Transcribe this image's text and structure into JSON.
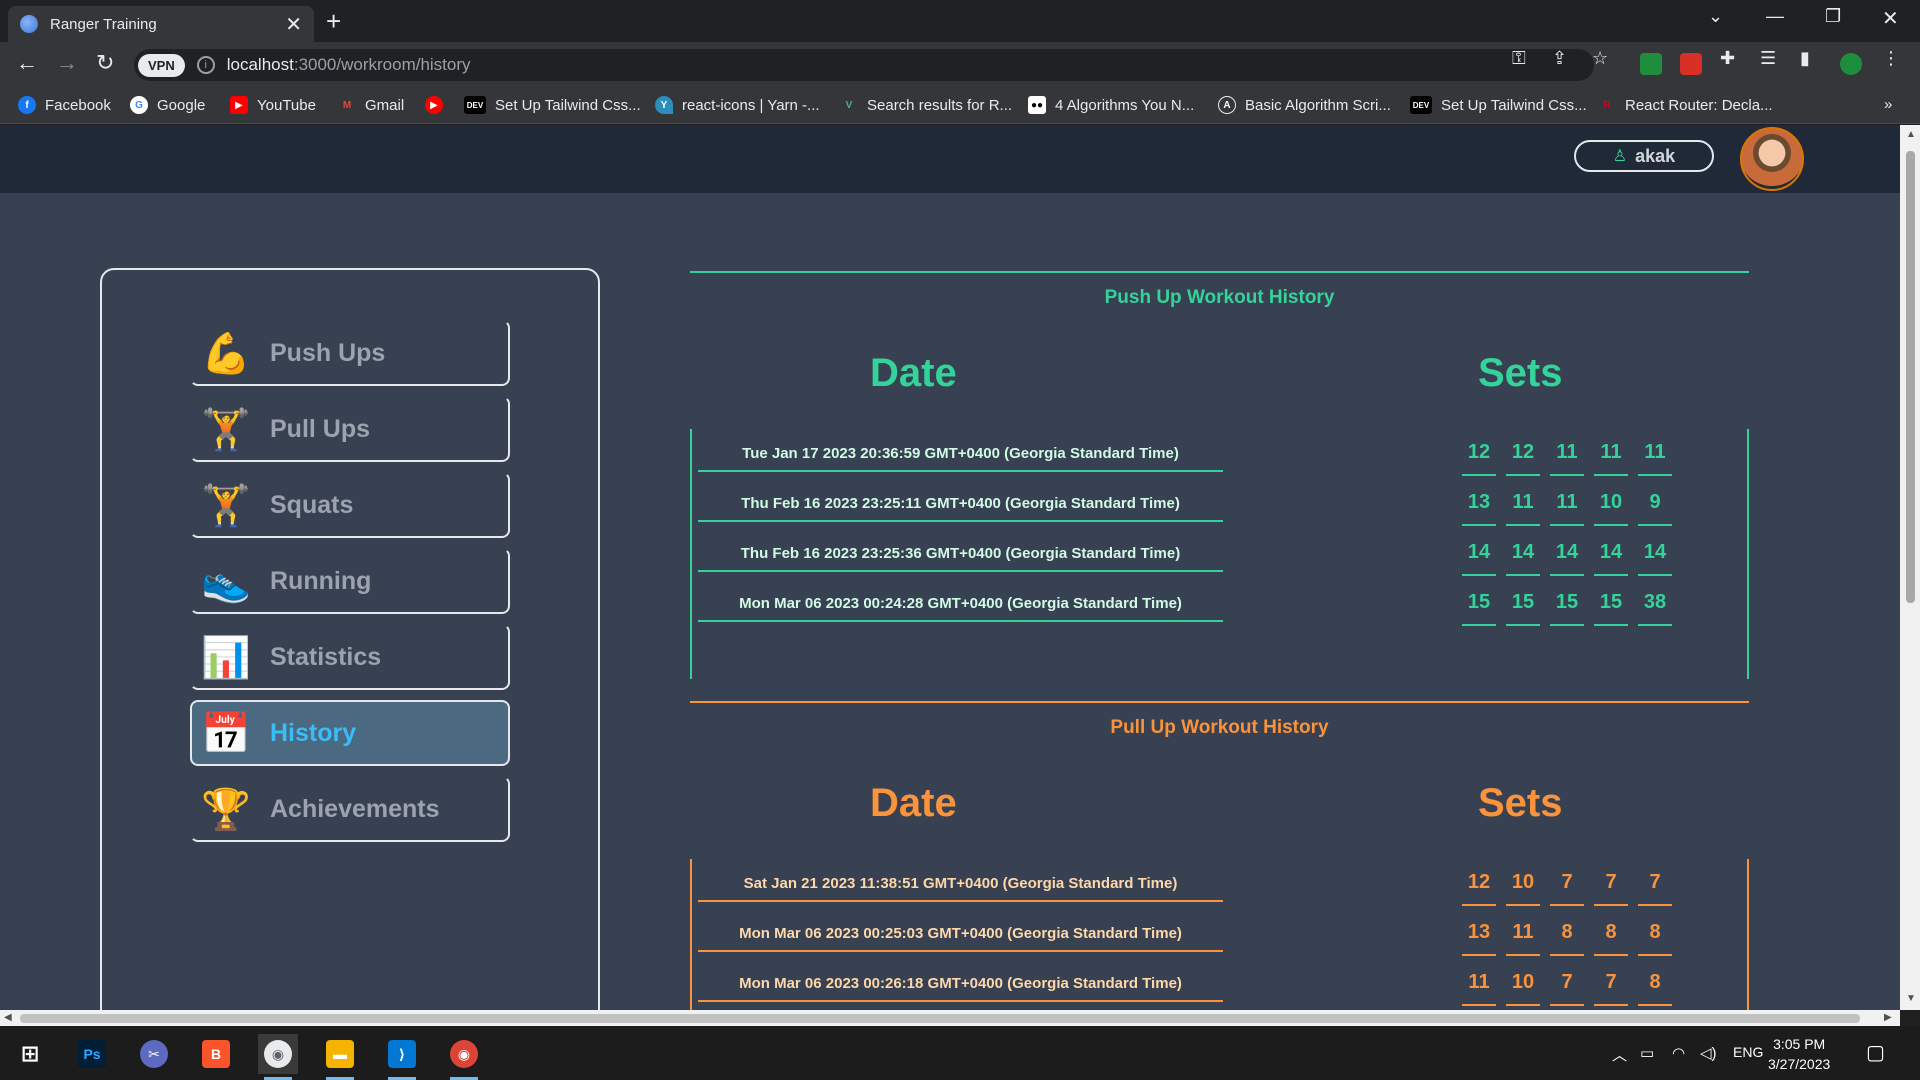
{
  "browser": {
    "tab_title": "Ranger Training",
    "tab_close": "✕",
    "new_tab": "+",
    "url_host": "localhost",
    "url_path": ":3000/workroom/history",
    "vpn_label": "VPN",
    "info_icon": "i"
  },
  "bookmarks": [
    {
      "label": "Facebook",
      "icon": "f",
      "color": "#1877f2"
    },
    {
      "label": "Google",
      "icon": "G",
      "color": "#ffffff"
    },
    {
      "label": "YouTube",
      "icon": "▶",
      "color": "#ff0000"
    },
    {
      "label": "Gmail",
      "icon": "M",
      "color": "#ea4335"
    },
    {
      "label": "",
      "icon": "▶",
      "color": "#ff0000"
    },
    {
      "label": "Set Up Tailwind Css...",
      "icon": "DEV",
      "color": "#000000"
    },
    {
      "label": "react-icons | Yarn -...",
      "icon": "Y",
      "color": "#2c8ebb"
    },
    {
      "label": "Search results for R...",
      "icon": "V",
      "color": "#41b883"
    },
    {
      "label": "4 Algorithms You N...",
      "icon": "●●",
      "color": "#000000"
    },
    {
      "label": "Basic Algorithm Scri...",
      "icon": "A",
      "color": "#1f1f1f"
    },
    {
      "label": "Set Up Tailwind Css...",
      "icon": "DEV",
      "color": "#000000"
    },
    {
      "label": "React Router: Decla...",
      "icon": "R",
      "color": "#d0021b"
    }
  ],
  "bookmarks_more": "»",
  "user": {
    "name": "akak",
    "icon": "person-outline"
  },
  "nav": [
    {
      "label": "Push Ups",
      "icon": "💪",
      "name": "push-ups",
      "active": false
    },
    {
      "label": "Pull Ups",
      "icon": "🏋",
      "name": "pull-ups",
      "active": false
    },
    {
      "label": "Squats",
      "icon": "🏋",
      "name": "squats",
      "active": false
    },
    {
      "label": "Running",
      "icon": "👟",
      "name": "running",
      "active": false
    },
    {
      "label": "Statistics",
      "icon": "📊",
      "name": "statistics",
      "active": false
    },
    {
      "label": "History",
      "icon": "📅",
      "name": "history",
      "active": true
    },
    {
      "label": "Achievements",
      "icon": "🏆",
      "name": "achievements",
      "active": false
    }
  ],
  "pushup": {
    "title": "Push Up Workout History",
    "date_header": "Date",
    "sets_header": "Sets",
    "accent": "#34d399",
    "rows": [
      {
        "date": "Tue Jan 17 2023 20:36:59 GMT+0400 (Georgia Standard Time)",
        "sets": [
          "12",
          "12",
          "11",
          "11",
          "11"
        ]
      },
      {
        "date": "Thu Feb 16 2023 23:25:11 GMT+0400 (Georgia Standard Time)",
        "sets": [
          "13",
          "11",
          "11",
          "10",
          "9"
        ]
      },
      {
        "date": "Thu Feb 16 2023 23:25:36 GMT+0400 (Georgia Standard Time)",
        "sets": [
          "14",
          "14",
          "14",
          "14",
          "14"
        ]
      },
      {
        "date": "Mon Mar 06 2023 00:24:28 GMT+0400 (Georgia Standard Time)",
        "sets": [
          "15",
          "15",
          "15",
          "15",
          "38"
        ]
      }
    ]
  },
  "pullup": {
    "title": "Pull Up Workout History",
    "date_header": "Date",
    "sets_header": "Sets",
    "accent": "#fb923c",
    "rows": [
      {
        "date": "Sat Jan 21 2023 11:38:51 GMT+0400 (Georgia Standard Time)",
        "sets": [
          "12",
          "10",
          "7",
          "7",
          "7"
        ]
      },
      {
        "date": "Mon Mar 06 2023 00:25:03 GMT+0400 (Georgia Standard Time)",
        "sets": [
          "13",
          "11",
          "8",
          "8",
          "8"
        ]
      },
      {
        "date": "Mon Mar 06 2023 00:26:18 GMT+0400 (Georgia Standard Time)",
        "sets": [
          "11",
          "10",
          "7",
          "7",
          "8"
        ]
      }
    ]
  },
  "taskbar": {
    "apps": [
      "windows-start",
      "photoshop",
      "snipping-tool",
      "brave",
      "chrome-alt",
      "file-explorer",
      "vscode",
      "chrome"
    ],
    "lang": "ENG",
    "time": "3:05 PM",
    "date": "3/27/2023"
  }
}
